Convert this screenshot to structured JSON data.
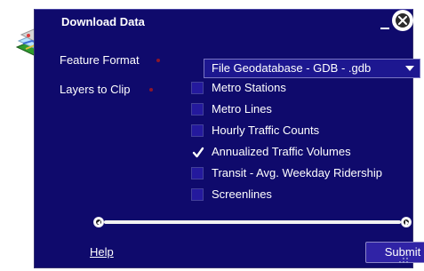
{
  "dialog": {
    "title": "Download Data",
    "colors": {
      "panel_bg": "#0f0a6c",
      "accent": "#1d1790",
      "required": "#8d1629",
      "text": "#ffffff"
    },
    "icons": {
      "app": "layers-map-icon",
      "minimize": "minimize-icon",
      "close": "close-icon",
      "select_arrow": "chevron-down-icon",
      "check": "checkmark-icon",
      "scroll_up": "scroll-up-icon",
      "scroll_down": "scroll-down-icon",
      "scroll_left": "scroll-left-icon",
      "scroll_right": "scroll-right-icon",
      "resize": "resize-grip-icon"
    }
  },
  "form": {
    "feature_format_label": "Feature Format",
    "feature_format_value": "File Geodatabase - GDB - .gdb",
    "layers_label": "Layers to Clip",
    "layers": [
      {
        "label": "Metro Stations",
        "checked": false
      },
      {
        "label": "Metro Lines",
        "checked": false
      },
      {
        "label": "Hourly Traffic Counts",
        "checked": false
      },
      {
        "label": "Annualized Traffic Volumes",
        "checked": true
      },
      {
        "label": "Transit - Avg. Weekday Ridership",
        "checked": false
      },
      {
        "label": "Screenlines",
        "checked": false
      }
    ]
  },
  "footer": {
    "help_label": "Help",
    "submit_label": "Submit"
  }
}
